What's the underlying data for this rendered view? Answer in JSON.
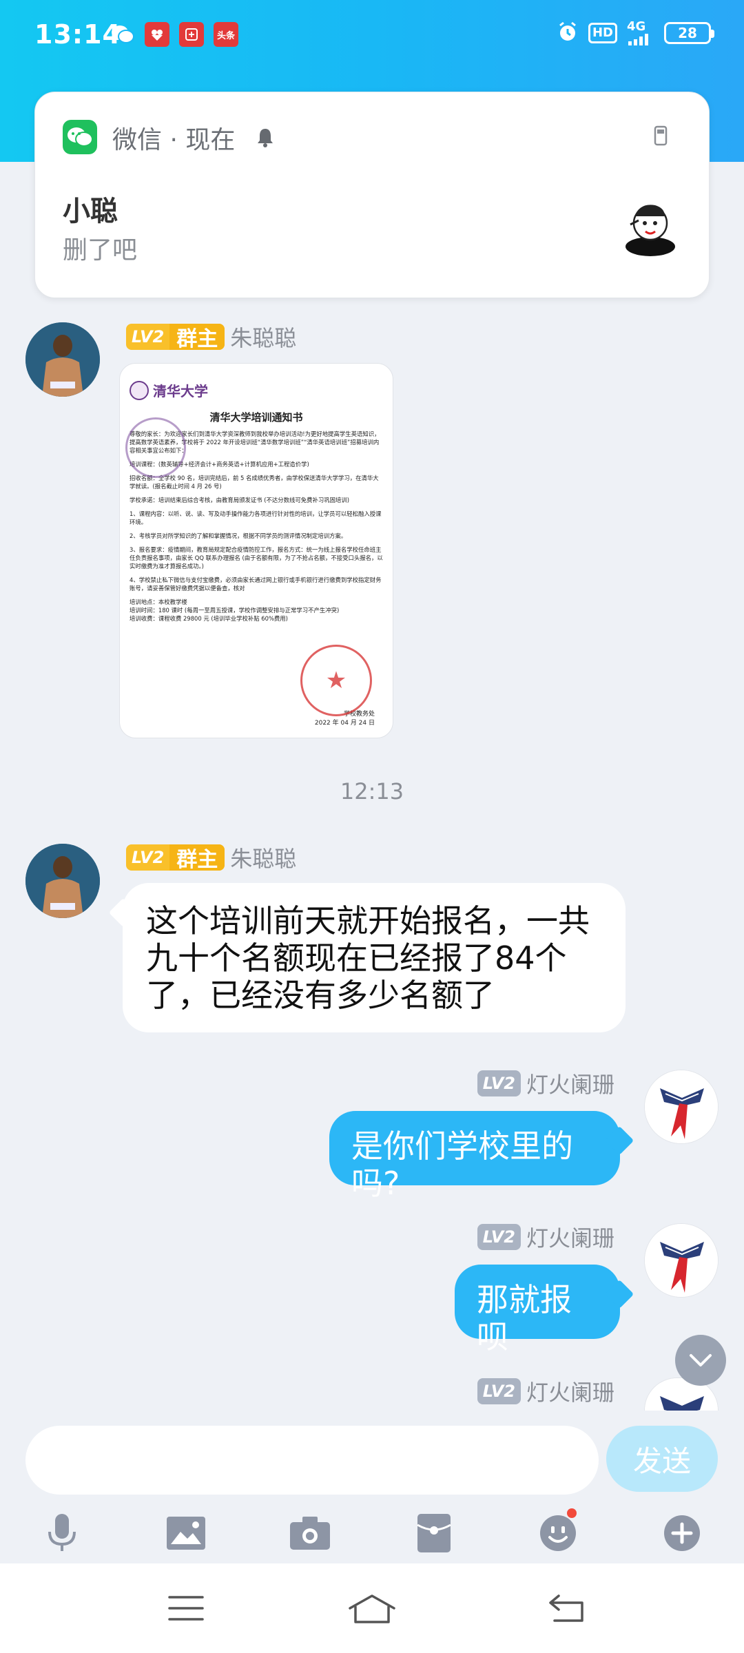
{
  "status_bar": {
    "time": "13:14",
    "hd": "HD",
    "network": "4G",
    "battery": "28",
    "app_icons": [
      "wechat-icon",
      "app-red-icon-1",
      "app-red-icon-2",
      "toutiao-icon"
    ],
    "toutiao_label": "头条"
  },
  "notification": {
    "app_name": "微信 · 现在",
    "sender": "小聪",
    "message": "删了吧"
  },
  "messages": [
    {
      "type": "image",
      "sender": {
        "level": "LV2",
        "role": "群主",
        "name": "朱聪聪"
      },
      "document": {
        "logo_text": "清华大学",
        "title": "清华大学培训通知书",
        "paragraphs": [
          "尊敬的家长：为欢迎家长们到清华大学资深教师到我校举办培训活动!为更好地提高学生英语知识，提高数学英语素养，学校将于 2022 年开设培训班“清华数学培训班”“清华英语培训班”招募培训内容相关事宜公布如下：",
          "培训课程：(数英辅导+经济会计+商务英语+计算机应用+工程造价学)",
          "招收名额：全学校 90 名，培训完结后，前 5 名成绩优秀者，由学校保送清华大学学习，在清华大学就读。(报名截止时间 4 月 26 号)",
          "学校承诺：培训结束后综合考核，由教育局颁发证书 (不达分数线可免费补习巩固培训)",
          "1、课程内容：以听、说、读、写及动手操作能力各项进行针对性的培训，让学员可以轻松融入授课环境。",
          "2、考核学员对所学知识的了解和掌握情况，根据不同学员的测评情况制定培训方案。",
          "3、报名要求：疫情期间，教育局规定配合疫情防控工作，报名方式：统一为线上报名学校任命班主任负责报名事项，由家长 QQ 联系办理报名 (由于名额有限，为了不抢占名额，不接受口头报名，以实时缴费为准才算报名成功。)",
          "4、学校禁止私下微信与支付宝缴费，必须由家长通过网上银行或手机银行进行缴费到学校指定财务账号，请妥善保管好缴费凭据以便备查，核对",
          "培训地点：本校教学楼",
          "培训时间：180 课时 (每周一至周五授课，学校作调整安排与正常学习不产生冲突)",
          "培训收费：课程收费 29800 元 (培训毕业学校补贴 60%费用)"
        ],
        "sign_office": "学校教务处",
        "sign_date": "2022 年 04 月 24 日"
      }
    },
    {
      "type": "divider",
      "text": "12:13"
    },
    {
      "type": "text",
      "side": "left",
      "sender": {
        "level": "LV2",
        "role": "群主",
        "name": "朱聪聪"
      },
      "lines": [
        "这个培训前天就开始报名，一共",
        "九十个名额现在已经报了84个",
        "了，已经没有多少名额了"
      ]
    },
    {
      "type": "text",
      "side": "right",
      "sender": {
        "level": "LV2",
        "name": "灯火阑珊"
      },
      "text": "是你们学校里的吗?"
    },
    {
      "type": "text",
      "side": "right",
      "sender": {
        "level": "LV2",
        "name": "灯火阑珊"
      },
      "text": "那就报呗"
    },
    {
      "type": "partial",
      "side": "right",
      "sender": {
        "level": "LV2",
        "name": "灯火阑珊"
      }
    }
  ],
  "input": {
    "value": "",
    "placeholder": "",
    "send_label": "发送"
  },
  "toolbar": [
    "microphone-icon",
    "image-icon",
    "camera-icon",
    "red-packet-icon",
    "emoji-icon",
    "plus-icon"
  ],
  "nav": [
    "menu-icon",
    "home-icon",
    "back-icon"
  ],
  "colors": {
    "header_gradient_start": "#14c8f2",
    "header_gradient_end": "#2aa8f7",
    "outgoing_bubble": "#2cb7f6",
    "incoming_bubble": "#ffffff",
    "chat_background": "#eef1f6",
    "owner_badge": "#f9c02a",
    "level_badge": "#aab3c2",
    "send_button_disabled": "#b8e8fb",
    "stamp_red": "#d62d2d"
  }
}
